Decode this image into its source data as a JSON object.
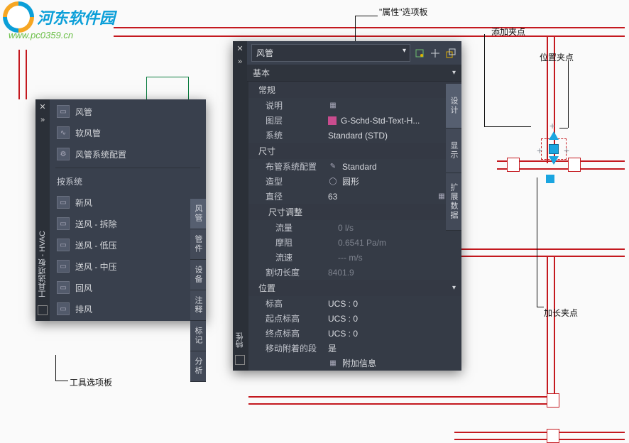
{
  "logo": {
    "text": "河东软件园",
    "url": "www.pc0359.cn"
  },
  "callouts": {
    "properties_panel": "\"属性\"选项板",
    "add_grip": "添加夹点",
    "location_grip": "位置夹点",
    "extend_grip": "加长夹点",
    "tool_palette": "工具选项板"
  },
  "tool_palette": {
    "title": "工具选项板 - HVAC",
    "items_top": [
      {
        "label": "风管",
        "icon": "duct-icon"
      },
      {
        "label": "软风管",
        "icon": "flex-duct-icon"
      },
      {
        "label": "风管系统配置",
        "icon": "duct-config-icon"
      }
    ],
    "group_header": "按系统",
    "items_sys": [
      {
        "label": "新风"
      },
      {
        "label": "送风 - 拆除"
      },
      {
        "label": "送风 - 低压"
      },
      {
        "label": "送风 - 中压"
      },
      {
        "label": "回风"
      },
      {
        "label": "排风"
      }
    ],
    "tabs": [
      "风管",
      "管件",
      "设备",
      "注释",
      "标记",
      "分析"
    ]
  },
  "properties": {
    "title": "特性",
    "select_value": "风管",
    "sections": {
      "basic": "基本",
      "general": {
        "header": "常规",
        "rows": {
          "desc_label": "说明",
          "desc_value": "",
          "layer_label": "图层",
          "layer_value": "G-Schd-Std-Text-H...",
          "system_label": "系统",
          "system_value": "Standard (STD)"
        }
      },
      "size": {
        "header": "尺寸",
        "rows": {
          "routing_label": "布管系统配置",
          "routing_value": "Standard",
          "shape_label": "造型",
          "shape_value": "圆形",
          "diameter_label": "直径",
          "diameter_value": "63"
        }
      },
      "size_adjust": {
        "header": "尺寸调整",
        "rows": {
          "flow_label": "流量",
          "flow_value": "0 l/s",
          "friction_label": "摩阻",
          "friction_value": "0.6541 Pa/m",
          "velocity_label": "流速",
          "velocity_value": "--- m/s",
          "cut_label": "割切长度",
          "cut_value": "8401.9"
        }
      },
      "position": {
        "header": "位置",
        "rows": {
          "elev_label": "标高",
          "elev_value": "UCS : 0",
          "start_label": "起点标高",
          "start_value": "UCS : 0",
          "end_label": "终点标高",
          "end_value": "UCS : 0",
          "move_label": "移动附着的段",
          "move_value": "是",
          "attach_label": "附加信息"
        }
      }
    },
    "tabs": [
      "设计",
      "显示",
      "扩展数据"
    ]
  }
}
